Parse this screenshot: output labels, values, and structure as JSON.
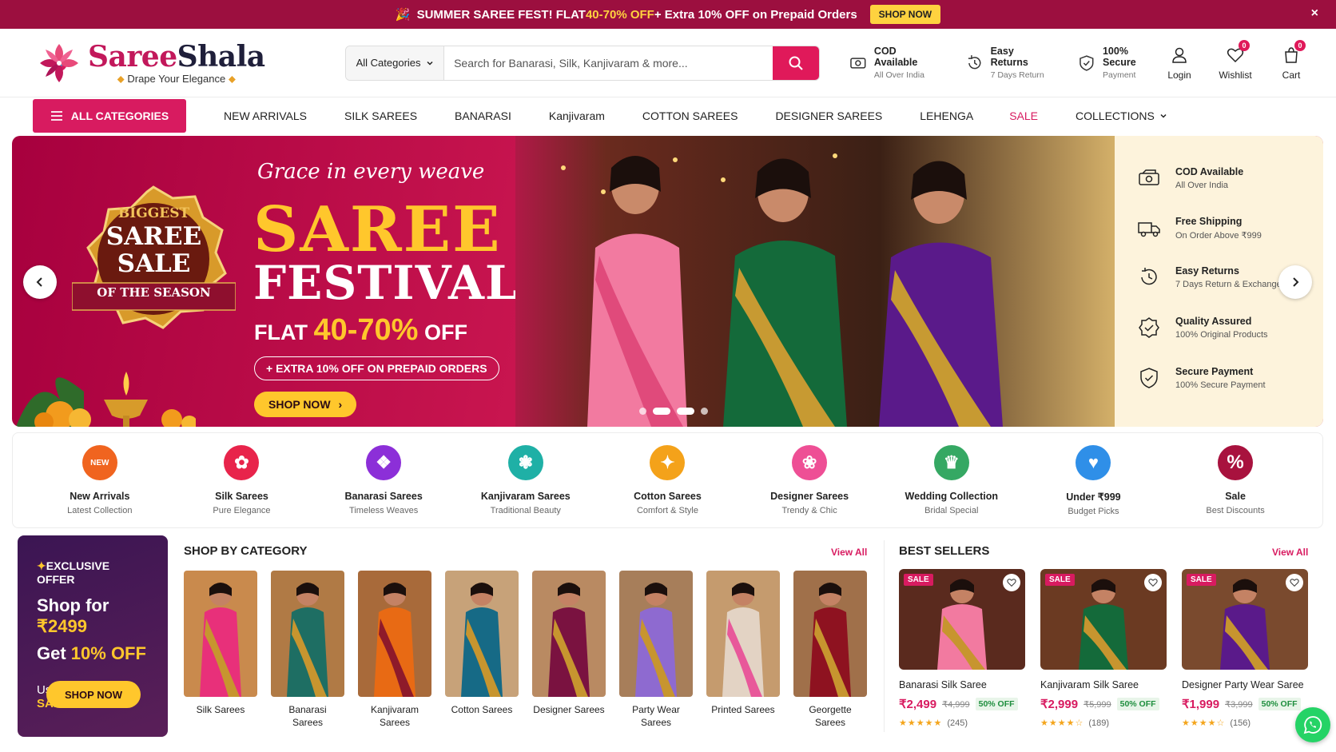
{
  "promo": {
    "emoji": "🎉",
    "text_a": "SUMMER SAREE FEST! FLAT ",
    "text_hl": "40-70% OFF",
    "text_b": " + Extra 10% OFF on Prepaid Orders",
    "button": "SHOP NOW",
    "close": "×"
  },
  "brand": {
    "name_a": "Saree",
    "name_b": "Shala",
    "tagline": "Drape Your Elegance"
  },
  "search": {
    "category": "All Categories",
    "placeholder": "Search for Banarasi, Silk, Kanjivaram & more..."
  },
  "header_features": [
    {
      "title": "COD Available",
      "sub": "All Over India",
      "icon": "cash-icon"
    },
    {
      "title": "Easy Returns",
      "sub": "7 Days Return",
      "icon": "return-icon"
    },
    {
      "title": "100% Secure",
      "sub": "Payment",
      "icon": "shield-icon"
    }
  ],
  "actions": {
    "login": "Login",
    "wishlist": "Wishlist",
    "wishlist_count": "0",
    "cart": "Cart",
    "cart_count": "0"
  },
  "nav": {
    "all_categories": "ALL CATEGORIES",
    "links": [
      "NEW ARRIVALS",
      "SILK SAREES",
      "BANARASI",
      "Kanjivaram",
      "COTTON SAREES",
      "DESIGNER SAREES",
      "LEHENGA",
      "SALE",
      "COLLECTIONS"
    ]
  },
  "hero": {
    "seal_top": "BIGGEST",
    "seal_mid1": "SAREE",
    "seal_mid2": "SALE",
    "seal_bottom": "OF THE SEASON",
    "script": "Grace in every weave",
    "headline1": "SAREE",
    "headline2": "FESTIVAL",
    "off_a": "FLAT ",
    "off_hl": "40-70%",
    "off_b": " OFF",
    "prepaid": "+ EXTRA 10% OFF ON PREPAID ORDERS",
    "shop": "SHOP NOW",
    "aside": [
      {
        "title": "COD Available",
        "sub": "All Over India"
      },
      {
        "title": "Free Shipping",
        "sub": "On Order Above ₹999"
      },
      {
        "title": "Easy Returns",
        "sub": "7 Days Return & Exchange"
      },
      {
        "title": "Quality Assured",
        "sub": "100% Original Products"
      },
      {
        "title": "Secure Payment",
        "sub": "100% Secure Payment"
      }
    ]
  },
  "categories": [
    {
      "title": "New Arrivals",
      "sub": "Latest Collection",
      "color": "#f0641f",
      "glyph": "NEW"
    },
    {
      "title": "Silk Sarees",
      "sub": "Pure Elegance",
      "color": "#e8244b",
      "glyph": "✿"
    },
    {
      "title": "Banarasi Sarees",
      "sub": "Timeless Weaves",
      "color": "#8c2fd8",
      "glyph": "❖"
    },
    {
      "title": "Kanjivaram Sarees",
      "sub": "Traditional Beauty",
      "color": "#1fb0a6",
      "glyph": "❃"
    },
    {
      "title": "Cotton Sarees",
      "sub": "Comfort & Style",
      "color": "#f4a21a",
      "glyph": "✦"
    },
    {
      "title": "Designer Sarees",
      "sub": "Trendy & Chic",
      "color": "#ee4f95",
      "glyph": "❀"
    },
    {
      "title": "Wedding Collection",
      "sub": "Bridal Special",
      "color": "#35a863",
      "glyph": "♛"
    },
    {
      "title": "Under ₹999",
      "sub": "Budget Picks",
      "color": "#2f8fe8",
      "glyph": "♥"
    },
    {
      "title": "Sale",
      "sub": "Best Discounts",
      "color": "#a8123e",
      "glyph": "%"
    }
  ],
  "offer": {
    "heading": "EXCLUSIVE OFFER",
    "spark": "✦",
    "line1_a": "Shop for ",
    "line1_b": "₹2499",
    "line2_a": "Get ",
    "line2_b": "10% OFF",
    "code_label": "Use Code: ",
    "code": "SAREE10",
    "button": "SHOP NOW"
  },
  "shop_by_category": {
    "title": "SHOP BY CATEGORY",
    "view_all": "View All",
    "items": [
      {
        "label": "Silk Sarees",
        "color": "#e8307a",
        "bg": "#c98a4d"
      },
      {
        "label": "Banarasi Sarees",
        "color": "#1e6e63",
        "bg": "#b07a45"
      },
      {
        "label": "Kanjivaram Sarees",
        "color": "#e86a14",
        "bg": "#a86a3a"
      },
      {
        "label": "Cotton Sarees",
        "color": "#166a86",
        "bg": "#c7a279"
      },
      {
        "label": "Designer Sarees",
        "color": "#7a1240",
        "bg": "#b98a62"
      },
      {
        "label": "Party Wear Sarees",
        "color": "#8e6ad0",
        "bg": "#a77e5a"
      },
      {
        "label": "Printed Sarees",
        "color": "#d9c6b4",
        "bg": "#c59b6e"
      },
      {
        "label": "Georgette Sarees",
        "color": "#8e1220",
        "bg": "#a0704a"
      }
    ]
  },
  "best_sellers": {
    "title": "BEST SELLERS",
    "view_all": "View All",
    "sale_tag": "SALE",
    "items": [
      {
        "name": "Banarasi Silk Saree",
        "price": "₹2,499",
        "mrp": "₹4,999",
        "discount": "50% OFF",
        "stars": "★★★★★",
        "reviews": "(245)",
        "color": "#f27aa0",
        "bg": "#5a2a1e"
      },
      {
        "name": "Kanjivaram Silk Saree",
        "price": "₹2,999",
        "mrp": "₹5,999",
        "discount": "50% OFF",
        "stars": "★★★★☆",
        "reviews": "(189)",
        "color": "#146a3a",
        "bg": "#6b3a22"
      },
      {
        "name": "Designer Party Wear Saree",
        "price": "₹1,999",
        "mrp": "₹3,999",
        "discount": "50% OFF",
        "stars": "★★★★☆",
        "reviews": "(156)",
        "color": "#5a1a8a",
        "bg": "#7a4a2e"
      }
    ]
  }
}
